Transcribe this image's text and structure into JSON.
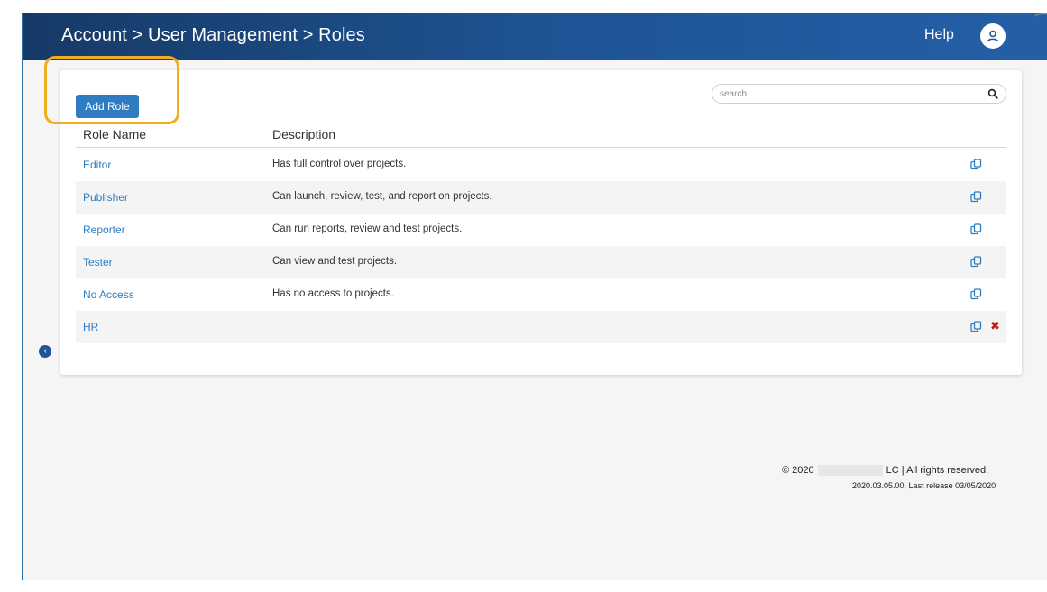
{
  "header": {
    "breadcrumb": "Account > User Management > Roles",
    "help_label": "Help",
    "avatar_icon": "user-icon"
  },
  "toolbar": {
    "add_role_label": "Add Role",
    "search_placeholder": "search",
    "search_icon": "search-icon"
  },
  "table": {
    "columns": [
      "Role Name",
      "Description"
    ],
    "rows": [
      {
        "name": "Editor",
        "description": "Has full control over projects.",
        "deletable": false
      },
      {
        "name": "Publisher",
        "description": "Can launch, review, test, and report on projects.",
        "deletable": false
      },
      {
        "name": "Reporter",
        "description": "Can run reports, review and test projects.",
        "deletable": false
      },
      {
        "name": "Tester",
        "description": "Can view and test projects.",
        "deletable": false
      },
      {
        "name": "No Access",
        "description": "Has no access to projects.",
        "deletable": false
      },
      {
        "name": "HR",
        "description": "",
        "deletable": true
      }
    ],
    "row_icons": [
      "copy-icon",
      "delete-icon"
    ]
  },
  "footer": {
    "copyright_prefix": "© 2020",
    "copyright_suffix": "LC | All rights reserved.",
    "release": "2020.03.05.00, Last release 03/05/2020"
  },
  "colors": {
    "header_bg": "#1f5597",
    "link": "#2e7dc2",
    "highlight": "#f0ad1f",
    "delete": "#b8201a"
  }
}
